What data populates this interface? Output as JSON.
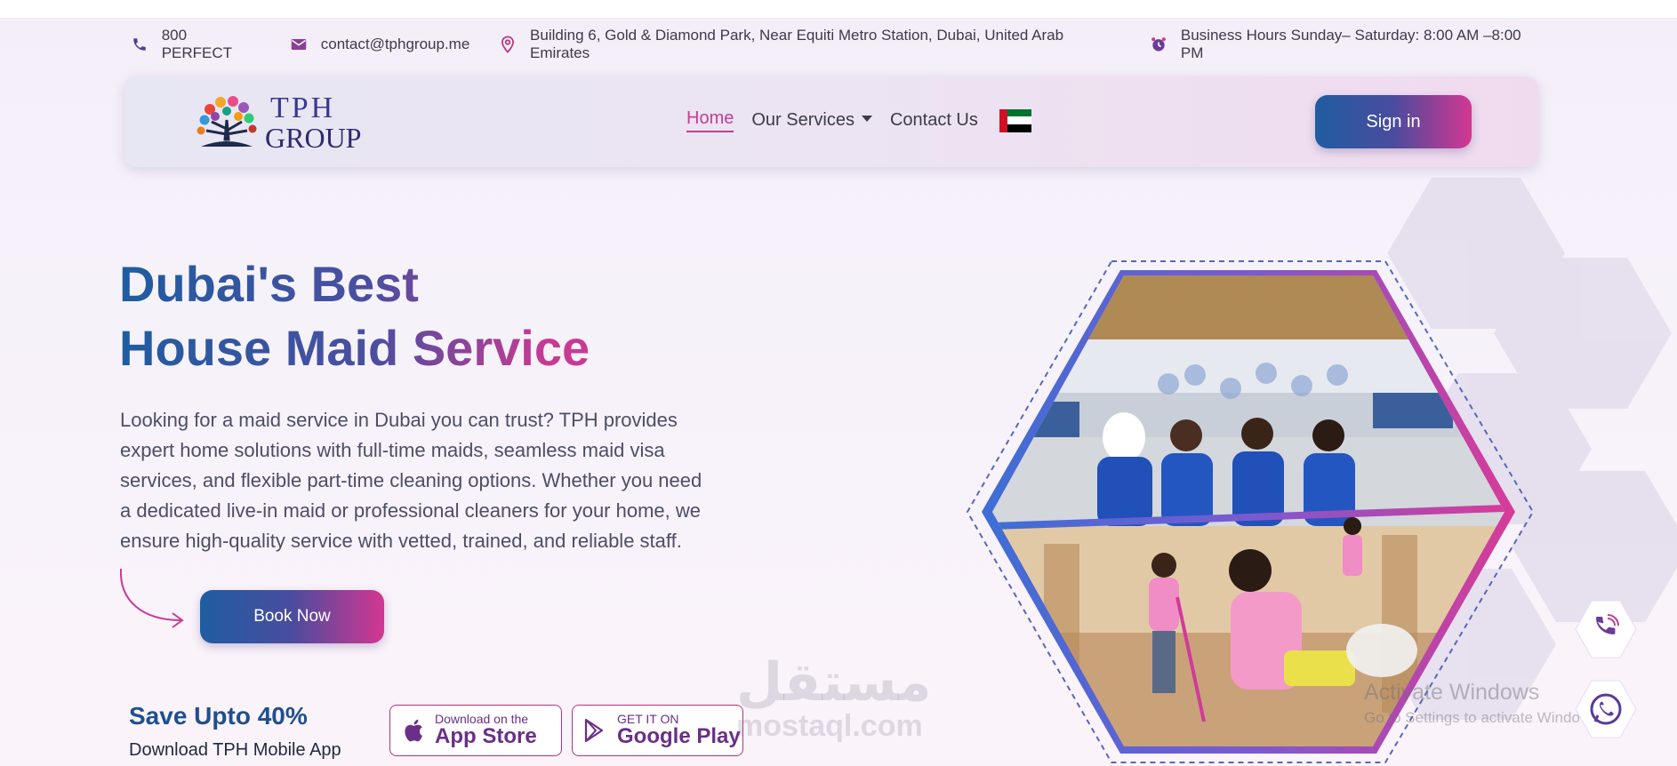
{
  "topbar": {
    "phone": "800 PERFECT",
    "email": "contact@tphgroup.me",
    "address": "Building 6, Gold & Diamond Park, Near Equiti Metro Station, Dubai, United Arab Emirates",
    "hours": "Business Hours Sunday– Saturday: 8:00 AM –8:00 PM"
  },
  "logo": {
    "line1": "TPH",
    "line2": "GROUP"
  },
  "nav": {
    "items": [
      {
        "label": "Home",
        "active": true
      },
      {
        "label": "Our Services",
        "active": false
      },
      {
        "label": "Contact Us",
        "active": false
      }
    ],
    "signin": "Sign in"
  },
  "hero": {
    "title_line1": "Dubai's Best",
    "title_line2": "House Maid Service",
    "description": "Looking for a maid service in Dubai you can trust? TPH provides expert home solutions with full-time maids, seamless maid visa services, and flexible part-time cleaning options. Whether you need a dedicated live-in maid or professional cleaners for your home, we ensure high-quality service with vetted, trained, and reliable staff.",
    "book_now": "Book Now"
  },
  "promo": {
    "save": "Save Upto 40%",
    "download": "Download TPH Mobile App",
    "appstore_small": "Download on the",
    "appstore_big": "App Store",
    "googleplay_small": "GET IT ON",
    "googleplay_big": "Google Play"
  },
  "overlay": {
    "watermark_ar": "مستقل",
    "watermark_en": "mostaql.com",
    "activate_title": "Activate Windows",
    "activate_sub": "Go to Settings to activate Windows."
  },
  "colors": {
    "brand_blue": "#1f5da0",
    "brand_pink": "#d33791",
    "brand_purple": "#6a2f86"
  },
  "icons": [
    "phone-icon",
    "mail-icon",
    "location-icon",
    "clock-icon",
    "apple-icon",
    "play-icon",
    "call-icon",
    "whatsapp-icon"
  ]
}
